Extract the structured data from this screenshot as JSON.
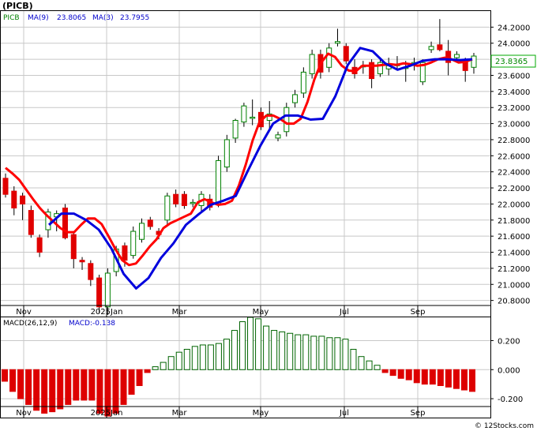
{
  "title": "(PICB)",
  "legend": {
    "ticker": "PICB",
    "ma9_label": "MA(9)",
    "ma9_value": "23.8065",
    "ma3_label": "MA(3)",
    "ma3_value": "23.7955"
  },
  "last_price": "23.8365",
  "macd_legend": {
    "label": "MACD(26,12,9)",
    "value_label": "MACD:-0.138"
  },
  "watermark": "© 12Stocks.com",
  "colors": {
    "up": "#008000",
    "down": "#e00000",
    "ma_fast": "#ff0000",
    "ma_slow": "#0000dd",
    "macd_pos": "#006400",
    "macd_neg": "#dd0000",
    "grid": "#c8c8c8",
    "last_price_box": "#00aa00"
  },
  "chart_data": [
    {
      "type": "candlestick",
      "title": "(PICB)",
      "x_tick_labels": [
        "Nov",
        "2025Jan",
        "Mar",
        "May",
        "Jul",
        "Sep"
      ],
      "y_tick_labels": [
        "24.2000",
        "24.0000",
        "23.8000",
        "23.6000",
        "23.4000",
        "23.2000",
        "23.0000",
        "22.8000",
        "22.6000",
        "22.4000",
        "22.2000",
        "22.0000",
        "21.8000",
        "21.6000",
        "21.4000",
        "21.2000",
        "21.0000",
        "20.8000"
      ],
      "ylim": [
        20.6,
        24.4
      ],
      "grid": true,
      "candles": [
        {
          "o": 22.32,
          "h": 22.38,
          "l": 22.08,
          "c": 22.12
        },
        {
          "o": 22.16,
          "h": 22.22,
          "l": 21.86,
          "c": 21.95
        },
        {
          "o": 22.1,
          "h": 22.14,
          "l": 21.8,
          "c": 22.0
        },
        {
          "o": 21.92,
          "h": 21.98,
          "l": 21.58,
          "c": 21.62
        },
        {
          "o": 21.58,
          "h": 21.62,
          "l": 21.34,
          "c": 21.4
        },
        {
          "o": 21.68,
          "h": 21.94,
          "l": 21.58,
          "c": 21.9
        },
        {
          "o": 21.84,
          "h": 21.92,
          "l": 21.66,
          "c": 21.88
        },
        {
          "o": 21.95,
          "h": 22.0,
          "l": 21.56,
          "c": 21.58
        },
        {
          "o": 21.62,
          "h": 21.66,
          "l": 21.2,
          "c": 21.32
        },
        {
          "o": 21.3,
          "h": 21.34,
          "l": 21.18,
          "c": 21.28
        },
        {
          "o": 21.26,
          "h": 21.3,
          "l": 20.98,
          "c": 21.06
        },
        {
          "o": 21.08,
          "h": 21.12,
          "l": 20.64,
          "c": 20.72
        },
        {
          "o": 20.72,
          "h": 21.2,
          "l": 20.62,
          "c": 21.14
        },
        {
          "o": 21.16,
          "h": 21.48,
          "l": 21.1,
          "c": 21.44
        },
        {
          "o": 21.48,
          "h": 21.52,
          "l": 21.22,
          "c": 21.3
        },
        {
          "o": 21.36,
          "h": 21.72,
          "l": 21.32,
          "c": 21.66
        },
        {
          "o": 21.56,
          "h": 21.82,
          "l": 21.52,
          "c": 21.76
        },
        {
          "o": 21.8,
          "h": 21.84,
          "l": 21.68,
          "c": 21.72
        },
        {
          "o": 21.66,
          "h": 21.7,
          "l": 21.56,
          "c": 21.62
        },
        {
          "o": 21.8,
          "h": 22.14,
          "l": 21.74,
          "c": 22.1
        },
        {
          "o": 22.12,
          "h": 22.18,
          "l": 21.96,
          "c": 22.0
        },
        {
          "o": 22.12,
          "h": 22.16,
          "l": 21.94,
          "c": 21.98
        },
        {
          "o": 22.02,
          "h": 22.06,
          "l": 21.96,
          "c": 22.02
        },
        {
          "o": 21.98,
          "h": 22.16,
          "l": 21.9,
          "c": 22.12
        },
        {
          "o": 22.06,
          "h": 22.12,
          "l": 21.92,
          "c": 21.96
        },
        {
          "o": 22.0,
          "h": 22.6,
          "l": 21.96,
          "c": 22.54
        },
        {
          "o": 22.46,
          "h": 22.86,
          "l": 22.4,
          "c": 22.8
        },
        {
          "o": 22.82,
          "h": 23.06,
          "l": 22.76,
          "c": 23.04
        },
        {
          "o": 23.02,
          "h": 23.26,
          "l": 22.96,
          "c": 23.22
        },
        {
          "o": 23.08,
          "h": 23.3,
          "l": 22.98,
          "c": 23.08
        },
        {
          "o": 23.14,
          "h": 23.2,
          "l": 22.92,
          "c": 22.96
        },
        {
          "o": 23.04,
          "h": 23.28,
          "l": 22.94,
          "c": 23.12
        },
        {
          "o": 22.82,
          "h": 22.9,
          "l": 22.78,
          "c": 22.86
        },
        {
          "o": 22.9,
          "h": 23.26,
          "l": 22.84,
          "c": 23.2
        },
        {
          "o": 23.26,
          "h": 23.42,
          "l": 23.2,
          "c": 23.36
        },
        {
          "o": 23.38,
          "h": 23.7,
          "l": 23.32,
          "c": 23.64
        },
        {
          "o": 23.62,
          "h": 23.92,
          "l": 23.56,
          "c": 23.86
        },
        {
          "o": 23.86,
          "h": 23.92,
          "l": 23.56,
          "c": 23.64
        },
        {
          "o": 23.7,
          "h": 24.0,
          "l": 23.64,
          "c": 23.94
        },
        {
          "o": 24.0,
          "h": 24.18,
          "l": 23.96,
          "c": 24.02
        },
        {
          "o": 23.96,
          "h": 24.0,
          "l": 23.74,
          "c": 23.78
        },
        {
          "o": 23.7,
          "h": 23.8,
          "l": 23.56,
          "c": 23.62
        },
        {
          "o": 23.72,
          "h": 23.78,
          "l": 23.62,
          "c": 23.72
        },
        {
          "o": 23.76,
          "h": 23.8,
          "l": 23.44,
          "c": 23.56
        },
        {
          "o": 23.62,
          "h": 23.82,
          "l": 23.58,
          "c": 23.76
        },
        {
          "o": 23.68,
          "h": 23.82,
          "l": 23.6,
          "c": 23.72
        },
        {
          "o": 23.72,
          "h": 23.84,
          "l": 23.66,
          "c": 23.74
        },
        {
          "o": 23.7,
          "h": 23.78,
          "l": 23.52,
          "c": 23.7
        },
        {
          "o": 23.76,
          "h": 23.82,
          "l": 23.66,
          "c": 23.76
        },
        {
          "o": 23.52,
          "h": 23.8,
          "l": 23.48,
          "c": 23.76
        },
        {
          "o": 23.92,
          "h": 24.02,
          "l": 23.88,
          "c": 23.96
        },
        {
          "o": 23.98,
          "h": 24.3,
          "l": 23.9,
          "c": 23.92
        },
        {
          "o": 23.9,
          "h": 24.04,
          "l": 23.6,
          "c": 23.76
        },
        {
          "o": 23.82,
          "h": 23.9,
          "l": 23.76,
          "c": 23.86
        },
        {
          "o": 23.78,
          "h": 23.82,
          "l": 23.52,
          "c": 23.66
        },
        {
          "o": 23.7,
          "h": 23.88,
          "l": 23.62,
          "c": 23.84
        }
      ],
      "series": [
        {
          "name": "MA(3)",
          "values": [
            22.45,
            22.38,
            22.3,
            22.18,
            22.06,
            21.95,
            21.86,
            21.78,
            21.7,
            21.65,
            21.65,
            21.74,
            21.82,
            21.82,
            21.75,
            21.6,
            21.44,
            21.3,
            21.24,
            21.26,
            21.36,
            21.47,
            21.56,
            21.7,
            21.76,
            21.8,
            21.84,
            21.88,
            22.02,
            22.06,
            22.02,
            21.99,
            22.0,
            22.04,
            22.23,
            22.49,
            22.79,
            23.02,
            23.1,
            23.1,
            23.06,
            23.0,
            23.0,
            23.06,
            23.27,
            23.55,
            23.76,
            23.87,
            23.83,
            23.72,
            23.66,
            23.65,
            23.72,
            23.72,
            23.72,
            23.73,
            23.74,
            23.73,
            23.75,
            23.74,
            23.72,
            23.73,
            23.76,
            23.8,
            23.82,
            23.8,
            23.76,
            23.77,
            23.8
          ]
        },
        {
          "name": "MA(9)",
          "values": [
            21.74,
            21.88,
            21.88,
            21.8,
            21.68,
            21.45,
            21.13,
            20.95,
            21.08,
            21.33,
            21.51,
            21.74,
            21.87,
            21.99,
            22.04,
            22.1,
            22.42,
            22.73,
            23.0,
            23.1,
            23.1,
            23.05,
            23.06,
            23.34,
            23.73,
            23.94,
            23.9,
            23.75,
            23.67,
            23.72,
            23.78,
            23.8,
            23.8,
            23.79,
            23.8
          ]
        }
      ]
    },
    {
      "type": "bar",
      "title": "MACD(26,12,9)",
      "y_tick_labels": [
        "0.200",
        "0.000",
        "-0.200"
      ],
      "ylim": [
        -0.33,
        0.36
      ],
      "grid": true,
      "values": [
        -0.08,
        -0.15,
        -0.2,
        -0.24,
        -0.28,
        -0.3,
        -0.29,
        -0.27,
        -0.24,
        -0.21,
        -0.21,
        -0.21,
        -0.3,
        -0.32,
        -0.3,
        -0.24,
        -0.17,
        -0.11,
        -0.02,
        0.02,
        0.05,
        0.09,
        0.12,
        0.14,
        0.16,
        0.17,
        0.17,
        0.18,
        0.21,
        0.27,
        0.33,
        0.36,
        0.35,
        0.3,
        0.27,
        0.26,
        0.25,
        0.24,
        0.24,
        0.23,
        0.23,
        0.22,
        0.22,
        0.21,
        0.14,
        0.09,
        0.06,
        0.03,
        -0.02,
        -0.04,
        -0.06,
        -0.07,
        -0.09,
        -0.1,
        -0.1,
        -0.11,
        -0.12,
        -0.13,
        -0.14,
        -0.15
      ]
    }
  ]
}
